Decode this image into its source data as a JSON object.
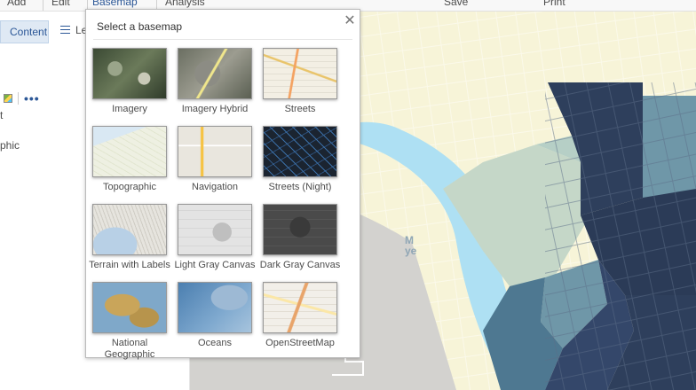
{
  "toolbar": {
    "items": [
      "Add",
      "Edit",
      "Basemap",
      "Analysis",
      "Save",
      "Print"
    ]
  },
  "left_panel": {
    "tab_content": "Content",
    "tab_legend": "Legend",
    "text1": "t",
    "text2": "phic"
  },
  "gallery": {
    "title": "Select a basemap",
    "close_glyph": "✕",
    "basemaps": [
      {
        "label": "Imagery"
      },
      {
        "label": "Imagery Hybrid"
      },
      {
        "label": "Streets"
      },
      {
        "label": "Topographic"
      },
      {
        "label": "Navigation"
      },
      {
        "label": "Streets (Night)"
      },
      {
        "label": "Terrain with Labels"
      },
      {
        "label": "Light Gray Canvas"
      },
      {
        "label": "Dark Gray Canvas"
      },
      {
        "label": "National Geographic"
      },
      {
        "label": "Oceans"
      },
      {
        "label": "OpenStreetMap"
      }
    ]
  },
  "map": {
    "label_water": "M",
    "label_water2": "ye"
  },
  "colors": {
    "accent": "#2b5797",
    "river": "#aee0f3",
    "land": "#f7f4d8",
    "gray_area": "#d3d2cf",
    "dark_choropleth": "#2e3f5c"
  }
}
